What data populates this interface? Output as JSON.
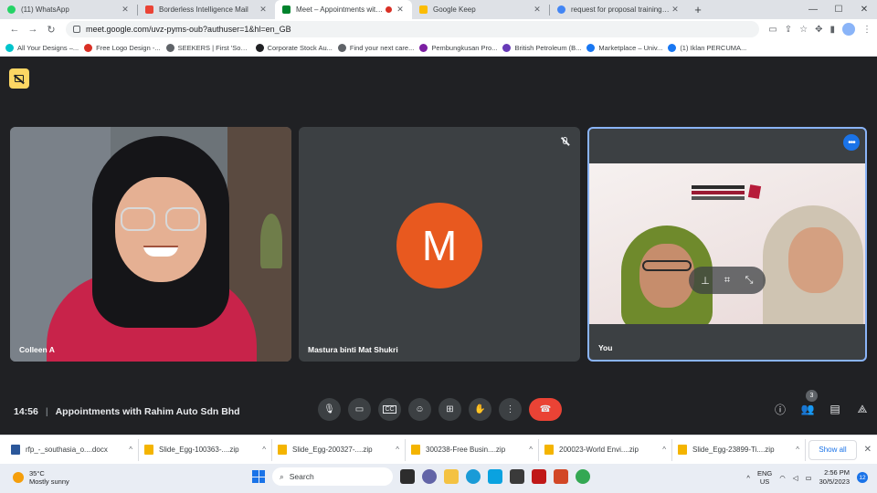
{
  "tabs": [
    {
      "label": "(11) WhatsApp",
      "color": "#25d366"
    },
    {
      "label": "Borderless Intelligence Mail",
      "color": "#ea4335"
    },
    {
      "label": "Meet – Appointments with R",
      "color": "#00832d",
      "active": true
    },
    {
      "label": "Google Keep",
      "color": "#fbbc04"
    },
    {
      "label": "request for proposal training ma",
      "color": "#4285f4"
    }
  ],
  "new_tab": "+",
  "window_controls": {
    "minimize": "—",
    "restore": "☐",
    "close": "✕"
  },
  "address": {
    "url": "meet.google.com/uvz-pyms-oub?authuser=1&hl=en_GB"
  },
  "bookmarks": [
    {
      "label": "All Your Designs –...",
      "color": "#00c4cc"
    },
    {
      "label": "Free Logo Design -...",
      "color": "#d93025"
    },
    {
      "label": "SEEKERS | First 'Soci...",
      "color": "#5f6368"
    },
    {
      "label": "Corporate Stock Au...",
      "color": "#202124"
    },
    {
      "label": "Find your next care...",
      "color": "#5f6368"
    },
    {
      "label": "Pembungkusan Pro...",
      "color": "#7b1fa2"
    },
    {
      "label": "British Petroleum (B...",
      "color": "#673ab7"
    },
    {
      "label": "Marketplace – Univ...",
      "color": "#1877f2"
    },
    {
      "label": "(1) Iklan PERCUMA...",
      "color": "#1877f2"
    }
  ],
  "participants": {
    "tile1_name": "Colleen A",
    "tile2_name": "Mastura binti Mat Shukri",
    "tile2_initial": "M",
    "tile3_name": "You"
  },
  "meeting": {
    "time": "14:56",
    "separator": "|",
    "title": "Appointments with Rahim Auto Sdn Bhd",
    "people_count": "3"
  },
  "downloads": [
    {
      "name": "rfp_-_southasia_o....docx",
      "color": "#2b579a"
    },
    {
      "name": "Slide_Egg-100363-....zip",
      "color": "#f4b400"
    },
    {
      "name": "Slide_Egg-200327-....zip",
      "color": "#f4b400"
    },
    {
      "name": "300238-Free Busin....zip",
      "color": "#f4b400"
    },
    {
      "name": "200023-World Envi....zip",
      "color": "#f4b400"
    },
    {
      "name": "Slide_Egg-23899-Ti....zip",
      "color": "#f4b400"
    }
  ],
  "show_all": "Show all",
  "taskbar": {
    "temp": "35°C",
    "weather": "Mostly sunny",
    "search": "Search",
    "lang_top": "ENG",
    "lang_bottom": "US",
    "time": "2:56 PM",
    "date": "30/5/2023",
    "notifications": "12"
  }
}
